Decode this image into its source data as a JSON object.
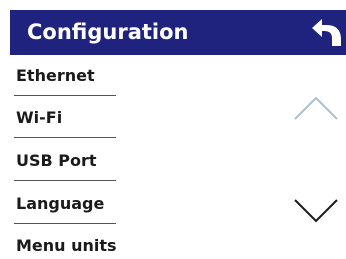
{
  "header": {
    "title": "Configuration",
    "back_icon": "back-arrow-icon"
  },
  "menu": {
    "items": [
      {
        "label": "Ethernet"
      },
      {
        "label": "Wi-Fi"
      },
      {
        "label": "USB Port"
      },
      {
        "label": "Language"
      },
      {
        "label": "Menu units"
      }
    ]
  },
  "scroll": {
    "up_icon": "chevron-up-icon",
    "down_icon": "chevron-down-icon",
    "up_enabled": false,
    "down_enabled": true
  },
  "colors": {
    "header_background": "#1f237e",
    "header_text": "#ffffff",
    "item_text": "#1a1a1a",
    "divider": "#555555",
    "arrow_disabled": "#a9c0d6",
    "arrow_enabled": "#1a1a1a"
  }
}
